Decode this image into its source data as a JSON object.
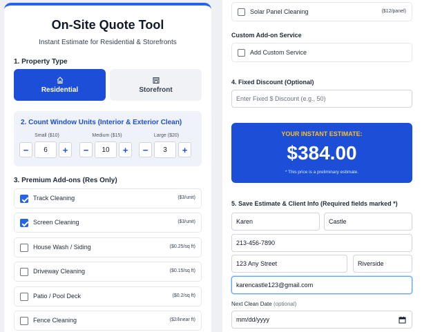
{
  "header": {
    "title": "On-Site Quote Tool",
    "subtitle": "Instant Estimate for Residential & Storefronts"
  },
  "property_type": {
    "label": "1. Property Type",
    "options": [
      {
        "label": "Residential",
        "icon": "house-icon",
        "selected": true
      },
      {
        "label": "Storefront",
        "icon": "storefront-icon",
        "selected": false
      }
    ]
  },
  "windows": {
    "label": "2. Count Window Units (Interior & Exterior Clean)",
    "groups": [
      {
        "label": "Small ($10)",
        "value": "6"
      },
      {
        "label": "Medium ($15)",
        "value": "10"
      },
      {
        "label": "Large ($20)",
        "value": "3"
      }
    ],
    "minus": "−",
    "plus": "+"
  },
  "premium": {
    "label": "3. Premium Add-ons (Res Only)",
    "items": [
      {
        "name": "Track Cleaning",
        "price": "($3/unit)",
        "checked": true
      },
      {
        "name": "Screen Cleaning",
        "price": "($3/unit)",
        "checked": true
      },
      {
        "name": "House Wash / Siding",
        "price": "($0.25/sq ft)",
        "checked": false
      },
      {
        "name": "Driveway Cleaning",
        "price": "($0.15/sq ft)",
        "checked": false
      },
      {
        "name": "Patio / Pool Deck",
        "price": "($0.2/sq ft)",
        "checked": false
      },
      {
        "name": "Fence Cleaning",
        "price": "($2/linear ft)",
        "checked": false
      }
    ]
  },
  "right": {
    "solar": {
      "name": "Solar Panel Cleaning",
      "price": "($12/panel)"
    },
    "custom_label": "Custom Add-on Service",
    "custom_button": "Add Custom Service",
    "discount_label": "4. Fixed Discount (Optional)",
    "discount_placeholder": "Enter Fixed $ Discount (e.g., 50)",
    "estimate": {
      "label": "YOUR INSTANT ESTIMATE:",
      "amount": "$384.00",
      "note": "* This price is a preliminary estimate."
    },
    "client_label": "5. Save Estimate & Client Info (Required fields marked *)",
    "client": {
      "first_name": "Karen",
      "last_name": "Castle",
      "phone": "213-456-7890",
      "street": "123 Any Street",
      "city": "Riverside",
      "email": "karencastle123@gmail.com"
    },
    "next_date_label": "Next Clean Date",
    "next_date_optional": "(optional)",
    "next_date_placeholder": "mm/dd/yyyy"
  },
  "colors": {
    "accent": "#1d4ed8",
    "estimate_label": "#fbbf24"
  }
}
